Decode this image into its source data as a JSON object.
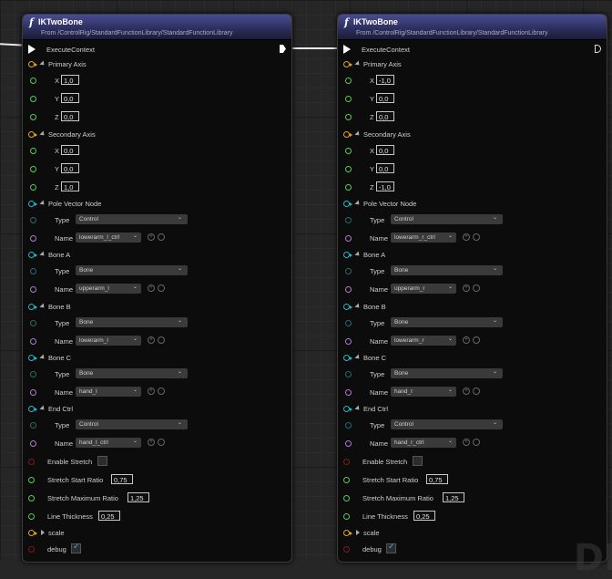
{
  "corner_watermark": "DI",
  "nodes": [
    {
      "title": "IKTwoBone",
      "subtitle": "From /ControlRig/StandardFunctionLibrary/StandardFunctionLibrary",
      "exec_label": "ExecuteContext",
      "primary_axis": {
        "label": "Primary Axis",
        "x": "1,0",
        "y": "0,0",
        "z": "0,0"
      },
      "secondary_axis": {
        "label": "Secondary Axis",
        "x": "0,0",
        "y": "0,0",
        "z": "1,0"
      },
      "groups": [
        {
          "label": "Pole Vector Node",
          "type": "Control",
          "name": "lowerarm_l_ctrl"
        },
        {
          "label": "Bone A",
          "type": "Bone",
          "name": "upperarm_l"
        },
        {
          "label": "Bone B",
          "type": "Bone",
          "name": "lowerarm_l"
        },
        {
          "label": "Bone C",
          "type": "Bone",
          "name": "hand_l"
        },
        {
          "label": "End Ctrl",
          "type": "Control",
          "name": "hand_l_ctrl"
        }
      ],
      "enable_stretch": "Enable Stretch",
      "stretch_start_ratio": {
        "label": "Stretch Start Ratio",
        "value": "0,75"
      },
      "stretch_max_ratio": {
        "label": "Stretch Maximum Ratio",
        "value": "1,25"
      },
      "line_thickness": {
        "label": "Line Thickness",
        "value": "0,25"
      },
      "scale": "scale",
      "debug": "debug"
    },
    {
      "title": "IKTwoBone",
      "subtitle": "From /ControlRig/StandardFunctionLibrary/StandardFunctionLibrary",
      "exec_label": "ExecuteContext",
      "primary_axis": {
        "label": "Primary Axis",
        "x": "-1,0",
        "y": "0,0",
        "z": "0,0"
      },
      "secondary_axis": {
        "label": "Secondary Axis",
        "x": "0,0",
        "y": "0,0",
        "z": "-1,0"
      },
      "groups": [
        {
          "label": "Pole Vector Node",
          "type": "Control",
          "name": "lowerarm_r_ctrl"
        },
        {
          "label": "Bone A",
          "type": "Bone",
          "name": "upperarm_r"
        },
        {
          "label": "Bone B",
          "type": "Bone",
          "name": "lowerarm_r"
        },
        {
          "label": "Bone C",
          "type": "Bone",
          "name": "hand_r"
        },
        {
          "label": "End Ctrl",
          "type": "Control",
          "name": "hand_r_ctrl"
        }
      ],
      "enable_stretch": "Enable Stretch",
      "stretch_start_ratio": {
        "label": "Stretch Start Ratio",
        "value": "0,75"
      },
      "stretch_max_ratio": {
        "label": "Stretch Maximum Ratio",
        "value": "1,25"
      },
      "line_thickness": {
        "label": "Line Thickness",
        "value": "0,25"
      },
      "scale": "scale",
      "debug": "debug"
    }
  ]
}
